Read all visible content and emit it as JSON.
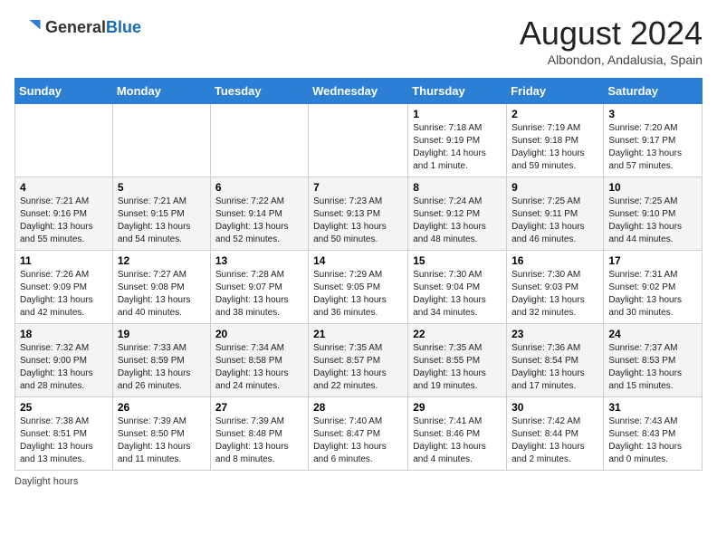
{
  "header": {
    "logo_general": "General",
    "logo_blue": "Blue",
    "month_year": "August 2024",
    "location": "Albondon, Andalusia, Spain"
  },
  "days_of_week": [
    "Sunday",
    "Monday",
    "Tuesday",
    "Wednesday",
    "Thursday",
    "Friday",
    "Saturday"
  ],
  "weeks": [
    [
      {
        "day": "",
        "info": ""
      },
      {
        "day": "",
        "info": ""
      },
      {
        "day": "",
        "info": ""
      },
      {
        "day": "",
        "info": ""
      },
      {
        "day": "1",
        "info": "Sunrise: 7:18 AM\nSunset: 9:19 PM\nDaylight: 14 hours and 1 minute."
      },
      {
        "day": "2",
        "info": "Sunrise: 7:19 AM\nSunset: 9:18 PM\nDaylight: 13 hours and 59 minutes."
      },
      {
        "day": "3",
        "info": "Sunrise: 7:20 AM\nSunset: 9:17 PM\nDaylight: 13 hours and 57 minutes."
      }
    ],
    [
      {
        "day": "4",
        "info": "Sunrise: 7:21 AM\nSunset: 9:16 PM\nDaylight: 13 hours and 55 minutes."
      },
      {
        "day": "5",
        "info": "Sunrise: 7:21 AM\nSunset: 9:15 PM\nDaylight: 13 hours and 54 minutes."
      },
      {
        "day": "6",
        "info": "Sunrise: 7:22 AM\nSunset: 9:14 PM\nDaylight: 13 hours and 52 minutes."
      },
      {
        "day": "7",
        "info": "Sunrise: 7:23 AM\nSunset: 9:13 PM\nDaylight: 13 hours and 50 minutes."
      },
      {
        "day": "8",
        "info": "Sunrise: 7:24 AM\nSunset: 9:12 PM\nDaylight: 13 hours and 48 minutes."
      },
      {
        "day": "9",
        "info": "Sunrise: 7:25 AM\nSunset: 9:11 PM\nDaylight: 13 hours and 46 minutes."
      },
      {
        "day": "10",
        "info": "Sunrise: 7:25 AM\nSunset: 9:10 PM\nDaylight: 13 hours and 44 minutes."
      }
    ],
    [
      {
        "day": "11",
        "info": "Sunrise: 7:26 AM\nSunset: 9:09 PM\nDaylight: 13 hours and 42 minutes."
      },
      {
        "day": "12",
        "info": "Sunrise: 7:27 AM\nSunset: 9:08 PM\nDaylight: 13 hours and 40 minutes."
      },
      {
        "day": "13",
        "info": "Sunrise: 7:28 AM\nSunset: 9:07 PM\nDaylight: 13 hours and 38 minutes."
      },
      {
        "day": "14",
        "info": "Sunrise: 7:29 AM\nSunset: 9:05 PM\nDaylight: 13 hours and 36 minutes."
      },
      {
        "day": "15",
        "info": "Sunrise: 7:30 AM\nSunset: 9:04 PM\nDaylight: 13 hours and 34 minutes."
      },
      {
        "day": "16",
        "info": "Sunrise: 7:30 AM\nSunset: 9:03 PM\nDaylight: 13 hours and 32 minutes."
      },
      {
        "day": "17",
        "info": "Sunrise: 7:31 AM\nSunset: 9:02 PM\nDaylight: 13 hours and 30 minutes."
      }
    ],
    [
      {
        "day": "18",
        "info": "Sunrise: 7:32 AM\nSunset: 9:00 PM\nDaylight: 13 hours and 28 minutes."
      },
      {
        "day": "19",
        "info": "Sunrise: 7:33 AM\nSunset: 8:59 PM\nDaylight: 13 hours and 26 minutes."
      },
      {
        "day": "20",
        "info": "Sunrise: 7:34 AM\nSunset: 8:58 PM\nDaylight: 13 hours and 24 minutes."
      },
      {
        "day": "21",
        "info": "Sunrise: 7:35 AM\nSunset: 8:57 PM\nDaylight: 13 hours and 22 minutes."
      },
      {
        "day": "22",
        "info": "Sunrise: 7:35 AM\nSunset: 8:55 PM\nDaylight: 13 hours and 19 minutes."
      },
      {
        "day": "23",
        "info": "Sunrise: 7:36 AM\nSunset: 8:54 PM\nDaylight: 13 hours and 17 minutes."
      },
      {
        "day": "24",
        "info": "Sunrise: 7:37 AM\nSunset: 8:53 PM\nDaylight: 13 hours and 15 minutes."
      }
    ],
    [
      {
        "day": "25",
        "info": "Sunrise: 7:38 AM\nSunset: 8:51 PM\nDaylight: 13 hours and 13 minutes."
      },
      {
        "day": "26",
        "info": "Sunrise: 7:39 AM\nSunset: 8:50 PM\nDaylight: 13 hours and 11 minutes."
      },
      {
        "day": "27",
        "info": "Sunrise: 7:39 AM\nSunset: 8:48 PM\nDaylight: 13 hours and 8 minutes."
      },
      {
        "day": "28",
        "info": "Sunrise: 7:40 AM\nSunset: 8:47 PM\nDaylight: 13 hours and 6 minutes."
      },
      {
        "day": "29",
        "info": "Sunrise: 7:41 AM\nSunset: 8:46 PM\nDaylight: 13 hours and 4 minutes."
      },
      {
        "day": "30",
        "info": "Sunrise: 7:42 AM\nSunset: 8:44 PM\nDaylight: 13 hours and 2 minutes."
      },
      {
        "day": "31",
        "info": "Sunrise: 7:43 AM\nSunset: 8:43 PM\nDaylight: 13 hours and 0 minutes."
      }
    ]
  ],
  "footer": {
    "daylight_label": "Daylight hours"
  }
}
